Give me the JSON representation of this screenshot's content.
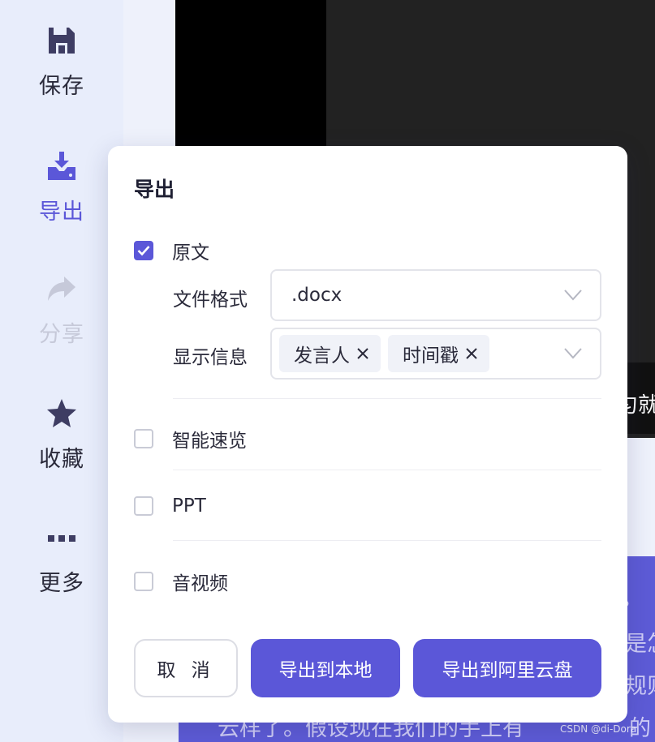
{
  "sidebar": {
    "items": [
      {
        "label": "保存",
        "icon": "save-icon"
      },
      {
        "label": "导出",
        "icon": "download-icon",
        "active": true
      },
      {
        "label": "分享",
        "icon": "share-icon",
        "disabled": true
      },
      {
        "label": "收藏",
        "icon": "star-icon"
      },
      {
        "label": "更多",
        "icon": "more-icon"
      }
    ]
  },
  "background": {
    "subtitle_fragment": "匀就",
    "text_lines": [
      "。",
      "是怎",
      "规则",
      "云样了。假设现在我们的手上有",
      "的"
    ],
    "watermark": "CSDN @di-Dora"
  },
  "dialog": {
    "title": "导出",
    "options": {
      "original": {
        "label": "原文",
        "checked": true
      },
      "smart_preview": {
        "label": "智能速览",
        "checked": false
      },
      "ppt": {
        "label": "PPT",
        "checked": false
      },
      "audio_video": {
        "label": "音视频",
        "checked": false
      }
    },
    "file_format": {
      "label": "文件格式",
      "value": ".docx"
    },
    "display_info": {
      "label": "显示信息",
      "tags": [
        "发言人",
        "时间戳"
      ]
    },
    "buttons": {
      "cancel": "取 消",
      "export_local": "导出到本地",
      "export_cloud": "导出到阿里云盘"
    }
  },
  "colors": {
    "accent": "#5b57d8",
    "sidebar_bg": "#e8edfb",
    "text": "#2a2a3a",
    "disabled": "#c6c9d9"
  }
}
